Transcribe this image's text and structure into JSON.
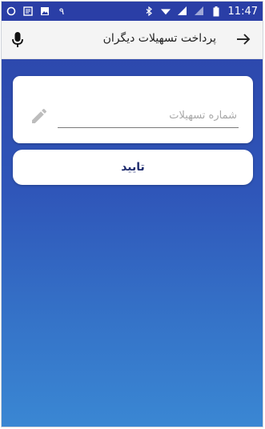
{
  "status_bar": {
    "time": "11:47",
    "left_icons": [
      "sync-icon",
      "notes-icon",
      "image-icon",
      "notification-9-icon"
    ],
    "left_text": "۹",
    "right_icons": [
      "bluetooth-icon",
      "wifi-icon",
      "signal-icon",
      "signal-icon",
      "battery-icon"
    ]
  },
  "app_bar": {
    "title": "پرداخت تسهیلات دیگران",
    "back_icon": "arrow-right-icon",
    "mic_icon": "mic-icon"
  },
  "form": {
    "facility_number": {
      "value": "",
      "placeholder": "شماره تسهیلات",
      "icon": "pencil-icon"
    },
    "confirm_label": "تایید"
  },
  "colors": {
    "gradient_top": "#2c43a8",
    "gradient_bottom": "#3a87d3",
    "status_bar": "#2a3ea6",
    "app_bar": "#f4f4f4",
    "button_text": "#1f2c6e"
  }
}
